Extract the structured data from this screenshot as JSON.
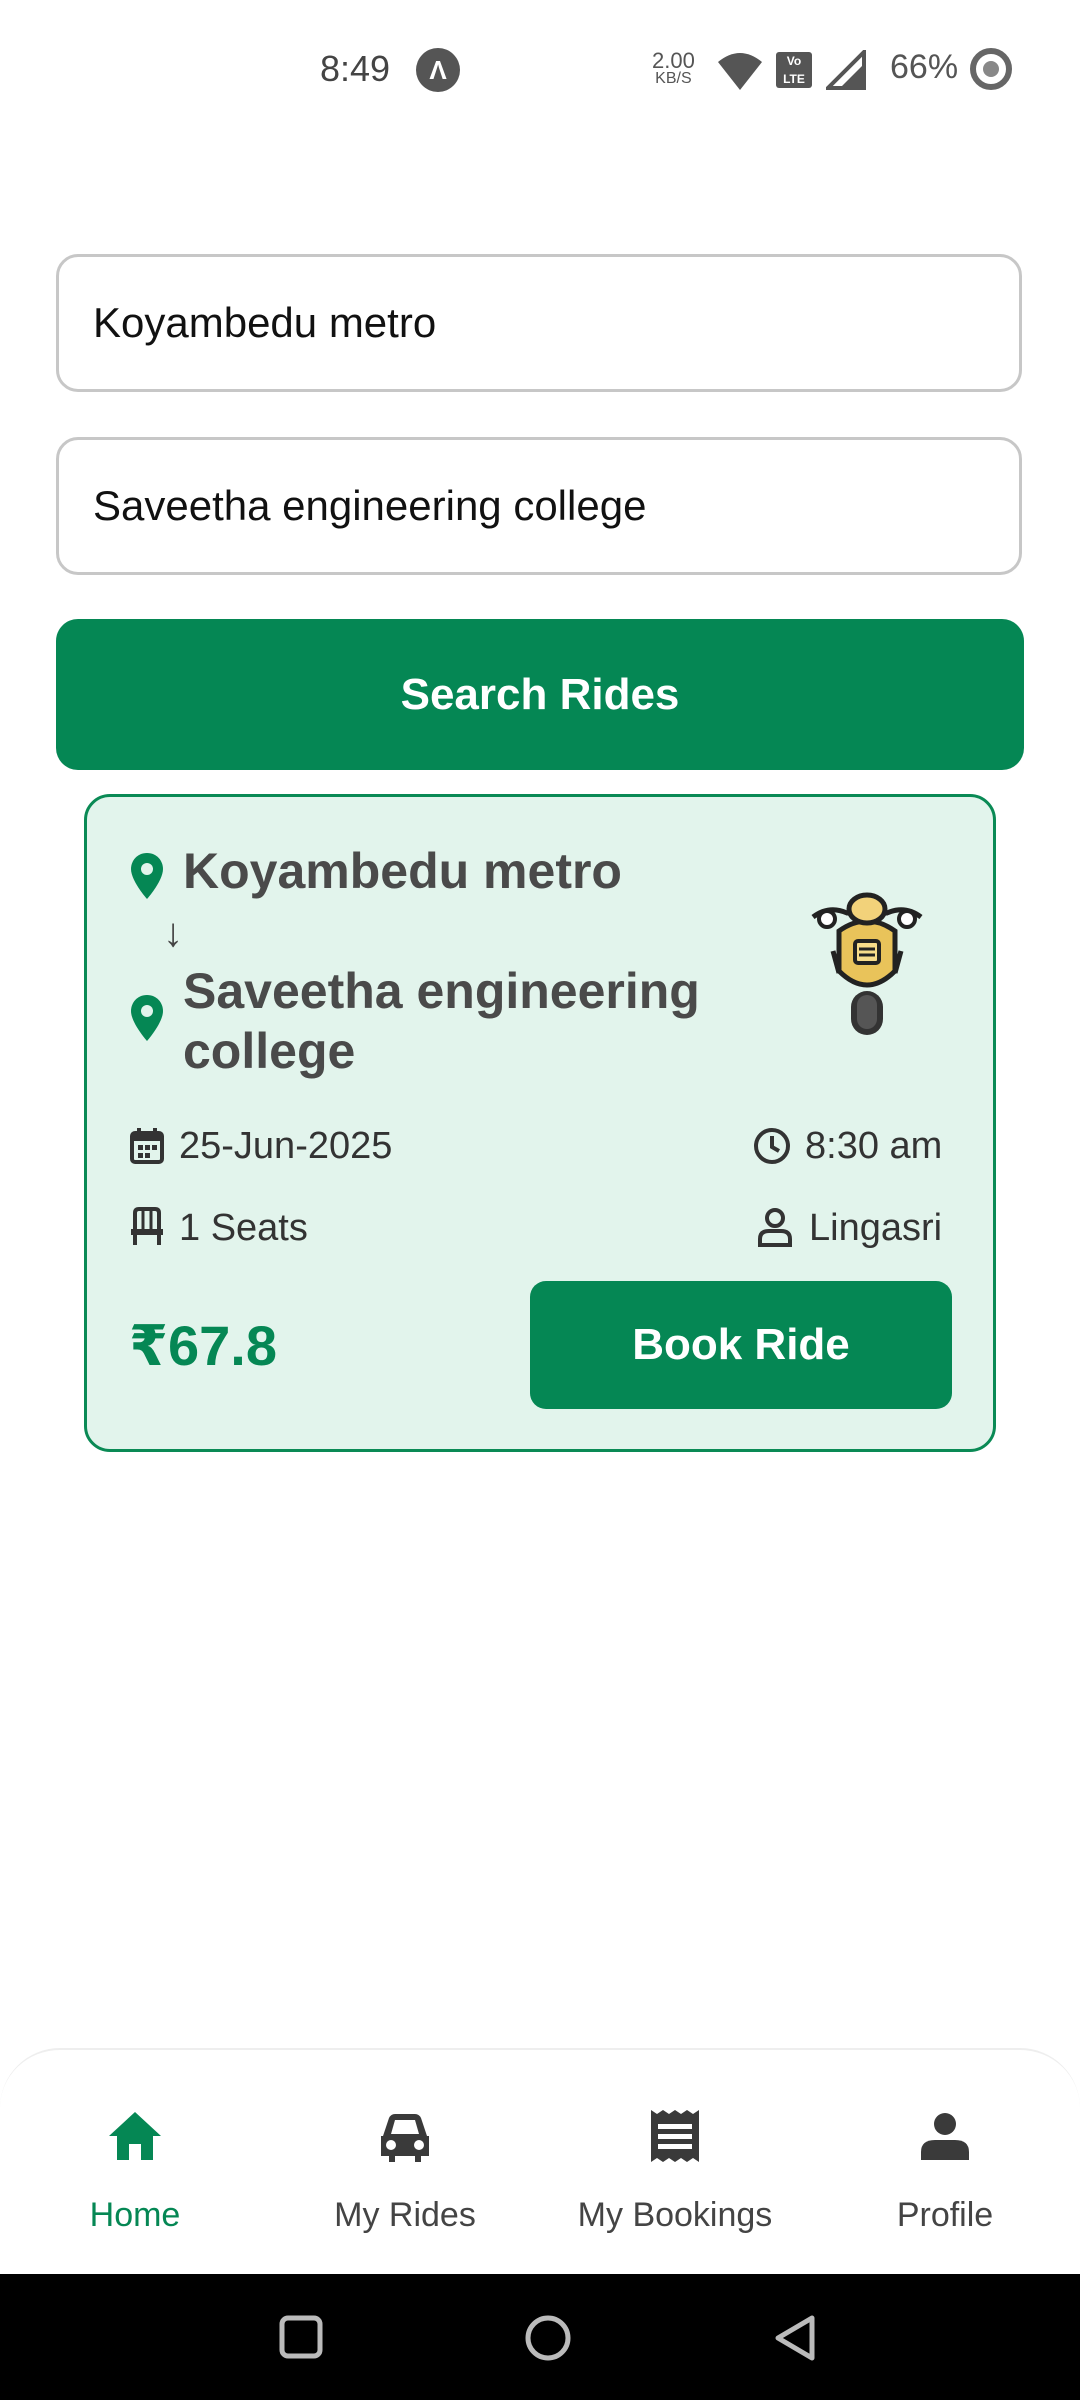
{
  "status_bar": {
    "time": "8:49",
    "app_icon": "Λ",
    "net_speed_value": "2.00",
    "net_speed_unit": "KB/S",
    "volte": "Vo LTE",
    "battery": "66%"
  },
  "search": {
    "from_value": "Koyambedu metro",
    "to_value": "Saveetha engineering college",
    "button_label": "Search Rides"
  },
  "ride": {
    "from": "Koyambedu metro",
    "to_line1": "Saveetha engineering",
    "to_line2": "college",
    "arrow": "↓",
    "date": "25-Jun-2025",
    "time": "8:30 am",
    "seats": "1 Seats",
    "driver": "Lingasri",
    "fare": "₹67.8",
    "book_label": "Book Ride",
    "vehicle_icon": "motorbike-icon"
  },
  "nav": {
    "items": [
      {
        "label": "Home",
        "icon": "home-icon",
        "active": true
      },
      {
        "label": "My Rides",
        "icon": "car-icon",
        "active": false
      },
      {
        "label": "My Bookings",
        "icon": "receipt-icon",
        "active": false
      },
      {
        "label": "Profile",
        "icon": "person-icon",
        "active": false
      }
    ]
  },
  "colors": {
    "accent": "#058754",
    "card_bg": "#e2f4ec",
    "card_border": "#0a8a55"
  }
}
